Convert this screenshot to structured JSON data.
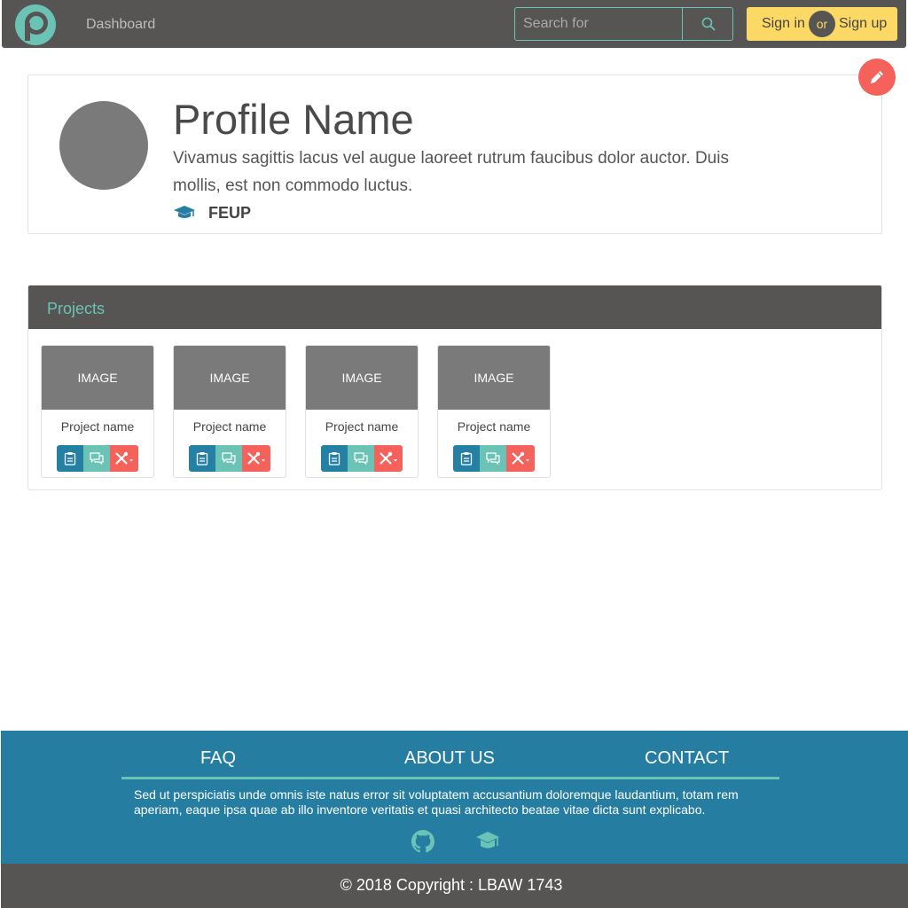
{
  "colors": {
    "dark": "#565553",
    "teal": "#6bc3b5",
    "blue": "#257ea2",
    "yellow": "#fcd964",
    "red": "#f4625b",
    "avatar_gray": "#7a7a7a"
  },
  "navbar": {
    "logo_icon": "p-logo-icon",
    "dashboard_label": "Dashboard",
    "search": {
      "placeholder": "Search for",
      "value": "",
      "icon": "search-icon"
    },
    "signin_label": "Sign in",
    "or_label": "or",
    "signup_label": "Sign up"
  },
  "profile": {
    "name": "Profile Name",
    "description": "Vivamus sagittis lacus vel augue laoreet rutrum faucibus dolor auctor. Duis mollis, est non commodo luctus.",
    "school_icon": "graduation-cap-icon",
    "school": "FEUP",
    "edit_icon": "pencil-icon"
  },
  "projects": {
    "title": "Projects",
    "items": [
      {
        "image_label": "IMAGE",
        "name": "Project name"
      },
      {
        "image_label": "IMAGE",
        "name": "Project name"
      },
      {
        "image_label": "IMAGE",
        "name": "Project name"
      },
      {
        "image_label": "IMAGE",
        "name": "Project name"
      }
    ],
    "button_icons": [
      "clipboard-icon",
      "chat-icon",
      "tools-icon"
    ]
  },
  "footer": {
    "links": [
      "FAQ",
      "ABOUT US",
      "CONTACT"
    ],
    "text": "Sed ut perspiciatis unde omnis iste natus error sit voluptatem accusantium doloremque laudantium, totam rem aperiam, eaque ipsa quae ab illo inventore veritatis et quasi architecto beatae vitae dicta sunt explicabo.",
    "icons": [
      "github-icon",
      "graduation-cap-icon"
    ],
    "copyright": "© 2018 Copyright : LBAW 1743"
  }
}
